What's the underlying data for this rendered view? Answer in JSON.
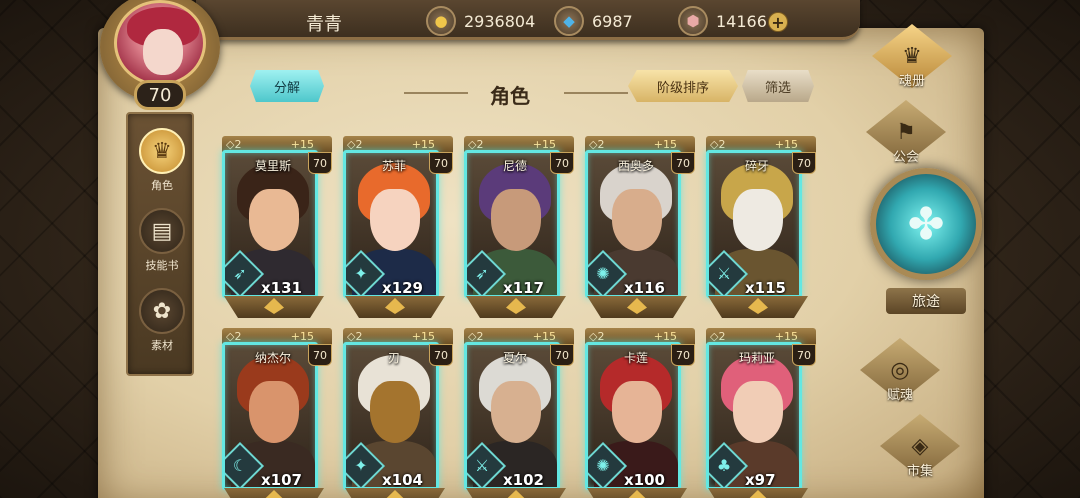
{
  "player": {
    "name": "青青",
    "level": "70"
  },
  "currencies": [
    {
      "icon": "gold-coin-icon",
      "glyph": "●",
      "value": "2936804"
    },
    {
      "icon": "blue-gem-icon",
      "glyph": "◆",
      "value": "6987"
    },
    {
      "icon": "pink-crystal-icon",
      "glyph": "⬢",
      "value": "14166"
    }
  ],
  "add_currency_label": "+",
  "left_nav": [
    {
      "label": "角色",
      "glyph": "♛",
      "active": true
    },
    {
      "label": "技能书",
      "glyph": "▤",
      "active": false
    },
    {
      "label": "素材",
      "glyph": "✿",
      "active": false
    }
  ],
  "header": {
    "title": "角色",
    "decompose_label": "分解",
    "sort_label": "阶级排序",
    "filter_label": "筛选"
  },
  "heroes": [
    {
      "name": "莫里斯",
      "stars": "◇2",
      "plus": "+15",
      "level": "70",
      "count": "x131",
      "class_glyph": "➶",
      "hair": "#3a2418",
      "face": "#e9b994",
      "body": "#2f2a30"
    },
    {
      "name": "苏菲",
      "stars": "◇2",
      "plus": "+15",
      "level": "70",
      "count": "x129",
      "class_glyph": "✦",
      "hair": "#e86a2c",
      "face": "#f6d3bf",
      "body": "#1d2b48"
    },
    {
      "name": "尼德",
      "stars": "◇2",
      "plus": "+15",
      "level": "70",
      "count": "x117",
      "class_glyph": "➶",
      "hair": "#5b3b7a",
      "face": "#c79a7a",
      "body": "#3c5a3a"
    },
    {
      "name": "西奥多",
      "stars": "◇2",
      "plus": "+15",
      "level": "70",
      "count": "x116",
      "class_glyph": "✺",
      "hair": "#d9d3cc",
      "face": "#d8ad8c",
      "body": "#4a3a30"
    },
    {
      "name": "碎牙",
      "stars": "◇2",
      "plus": "+15",
      "level": "70",
      "count": "x115",
      "class_glyph": "⚔",
      "hair": "#c8a64a",
      "face": "#eeeae2",
      "body": "#6a5530"
    },
    {
      "name": "纳杰尔",
      "stars": "◇2",
      "plus": "+15",
      "level": "70",
      "count": "x107",
      "class_glyph": "☾",
      "hair": "#9a3a1c",
      "face": "#d9946c",
      "body": "#3a2a22"
    },
    {
      "name": "刃",
      "stars": "◇2",
      "plus": "+15",
      "level": "70",
      "count": "x104",
      "class_glyph": "✦",
      "hair": "#e8e2d6",
      "face": "#a4742e",
      "body": "#5a4630"
    },
    {
      "name": "夏尔",
      "stars": "◇2",
      "plus": "+15",
      "level": "70",
      "count": "x102",
      "class_glyph": "⚔",
      "hair": "#dcdad4",
      "face": "#d7b090",
      "body": "#2b2624"
    },
    {
      "name": "卡莲",
      "stars": "◇2",
      "plus": "+15",
      "level": "70",
      "count": "x100",
      "class_glyph": "✺",
      "hair": "#b52a2a",
      "face": "#e6b496",
      "body": "#3a1a1a"
    },
    {
      "name": "玛莉亚",
      "stars": "◇2",
      "plus": "+15",
      "level": "70",
      "count": "x97",
      "class_glyph": "♣",
      "hair": "#e0607a",
      "face": "#f1cdb6",
      "body": "#5a3a2a"
    }
  ],
  "right_menu": {
    "soulbook": {
      "label": "魂册",
      "glyph": "♛"
    },
    "guild": {
      "label": "公会",
      "glyph": "⚑"
    },
    "journey": {
      "label": "旅途",
      "glyph": "✤"
    },
    "talent": {
      "label": "赋魂",
      "glyph": "◎"
    },
    "market": {
      "label": "市集",
      "glyph": "◈"
    }
  },
  "colors": {
    "accent_cyan": "#63e7e2",
    "gold": "#d8b466",
    "parchment": "#e2d0a8"
  }
}
